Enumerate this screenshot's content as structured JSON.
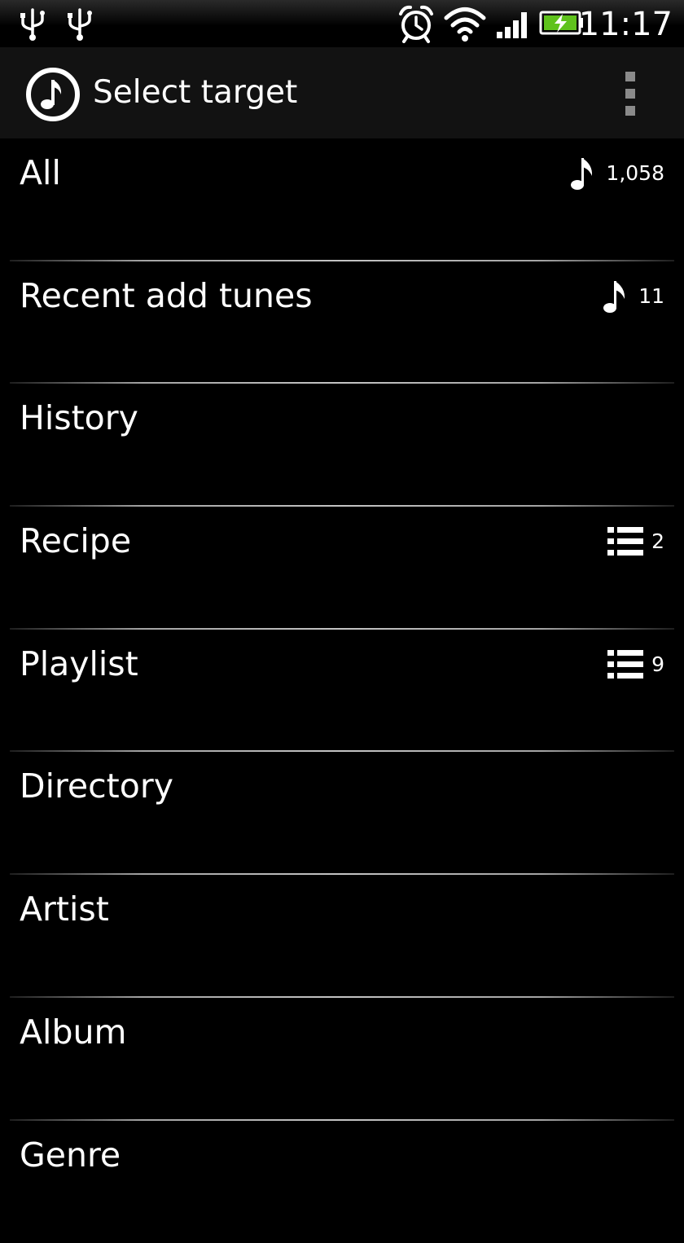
{
  "status_bar": {
    "time": "11:17",
    "icons": [
      "usb-icon",
      "usb-icon",
      "alarm-icon",
      "wifi-icon",
      "signal-icon",
      "battery-charging-icon"
    ]
  },
  "action_bar": {
    "title": "Select target",
    "app_icon": "music-note-icon",
    "menu_icon": "overflow-menu-icon"
  },
  "items": [
    {
      "label": "All",
      "count": "1,058",
      "icon": "music-note-icon"
    },
    {
      "label": "Recent add tunes",
      "count": "11",
      "icon": "music-note-icon"
    },
    {
      "label": "History"
    },
    {
      "label": "Recipe",
      "count": "2",
      "icon": "list-icon"
    },
    {
      "label": "Playlist",
      "count": "9",
      "icon": "list-icon"
    },
    {
      "label": "Directory"
    },
    {
      "label": "Artist"
    },
    {
      "label": "Album"
    },
    {
      "label": "Genre"
    }
  ],
  "colors": {
    "background": "#000000",
    "action_bar": "#121212",
    "text": "#ffffff",
    "battery_fill": "#5fc21c"
  }
}
